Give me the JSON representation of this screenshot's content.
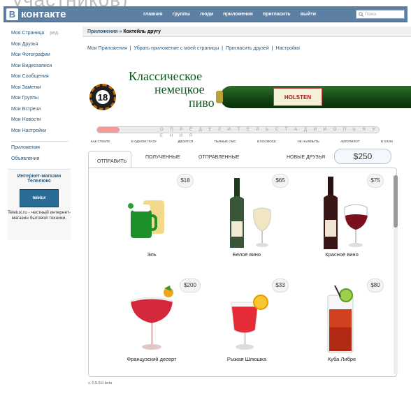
{
  "caption_top": "участников)",
  "app": {
    "logo_letter": "В",
    "logo_text": "контакте"
  },
  "topnav": [
    "главная",
    "группы",
    "люди",
    "приложения",
    "пригласить",
    "выйти"
  ],
  "search": {
    "placeholder": "Поиск"
  },
  "sidebar": {
    "my_page": "Моя Страница",
    "my_page_edit": "ред.",
    "items": [
      "Мои Друзья",
      "Мои Фотографии",
      "Мои Видеозаписи",
      "Мои Сообщения",
      "Мои Заметки",
      "Мои Группы",
      "Мои Встречи",
      "Мои Новости",
      "Мои Настройки"
    ],
    "extra": [
      "Приложения",
      "Объявления"
    ],
    "promo": {
      "title": "Интернет-магазин Телелюкс",
      "banner": "telelux",
      "text": "Telelux.ru - честный интернет-магазин бытовой техники."
    }
  },
  "breadcrumb": {
    "prefix": "Приложения »",
    "current": "Коктейль другу"
  },
  "app_links": [
    "Мои Приложения",
    "Убрать приложение с моей страницы",
    "Пригласить друзей",
    "Настройки"
  ],
  "ad": {
    "line1": "Классическое",
    "line2": "немецкое",
    "line3": "пиво",
    "age": "18",
    "brand": "HOLSTEN"
  },
  "scale": {
    "text": "О П Р Е Д Е Л И Т Е Л Ь   С Т А Д И И   О П Ь Я Н Е Н И Я",
    "level_fraction": 0.08
  },
  "levels": [
    "КАК СТЕКЛО",
    "В ОДНОМ ГЛАЗУ",
    "ДВОИТСЯ",
    "ПЬЯНЫЕ СМС",
    "В КОСМОСЕ",
    "НЕ НАЛИВАТЬ",
    "АВТОПИЛОТ",
    "В ХЛАМ"
  ],
  "tabs": [
    "ОТПРАВИТЬ",
    "ПОЛУЧЕННЫЕ",
    "ОТПРАВЛЕННЫЕ",
    "НОВЫЕ ДРУЗЬЯ"
  ],
  "balance": "$250",
  "drinks": [
    {
      "name": "Эль",
      "price": "$18"
    },
    {
      "name": "Белое вино",
      "price": "$65"
    },
    {
      "name": "Красное вино",
      "price": "$75"
    },
    {
      "name": "Французский десерт",
      "price": "$200"
    },
    {
      "name": "Рыжая Шлюшка",
      "price": "$33"
    },
    {
      "name": "Куба Либре",
      "price": "$80"
    }
  ],
  "version": "v. 0.5.8.0 beta",
  "colors": {
    "header": "#5d7fa3",
    "link": "#2b587a",
    "ad_green": "#0d5a1e"
  }
}
